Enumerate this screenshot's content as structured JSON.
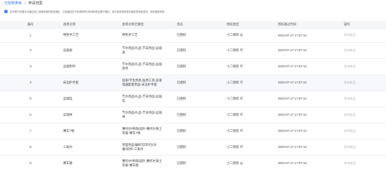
{
  "breadcrumb": {
    "parent": "已授权类目",
    "current": "申请范围"
  },
  "notice": {
    "text": "本列表中仅展示已通过线上流程申请的类目授权，之前通过线下申请获得已申请的类目暂不展示，如不影响您的发布授权的商品发布，请您重新申请"
  },
  "table": {
    "headers": [
      "编号",
      "类目名称",
      "类目名称全路径",
      "状态",
      "授权类型",
      "授权通过时间",
      "操作"
    ],
    "rows": [
      {
        "idx": "1",
        "name": "特色手工艺",
        "path": [
          "特色手工艺"
        ],
        "status": "已授权",
        "type": "小二授权",
        "time": "2023-07-17 17:07:13",
        "action": "发布商品"
      },
      {
        "idx": "2",
        "name": "盆栽类",
        "path": [
          "节水用品/礼品-节日用品-盆栽",
          "类"
        ],
        "status": "已授权",
        "type": "小二授权",
        "time": "2023-07-17 17:07:13",
        "action": "发布商品"
      },
      {
        "idx": "3",
        "name": "盆栽附件",
        "path": [
          "节水用品/礼品-节日用品-盆栽",
          "附件"
        ],
        "status": "已授权",
        "type": "小二授权",
        "time": "2023-07-17 17:07:13",
        "action": "发布商品"
      },
      {
        "idx": "4",
        "name": "床边护手套",
        "path": [
          "居家/学生用具-医用工具-居家",
          "电器配套用品-床边护手套"
        ],
        "status": "已授权",
        "type": "小二授权",
        "time": "2023-07-17 17:07:13",
        "action": "发布商品"
      },
      {
        "idx": "5",
        "name": "盆栽桂",
        "path": [
          "节水用品/礼品-节日用品-盆栽",
          "桂"
        ],
        "status": "已授权",
        "type": "小二授权",
        "time": "2023-07-17 17:07:13",
        "action": "发布商品"
      },
      {
        "idx": "6",
        "name": "盆栽林",
        "path": [
          "节水用品/礼品-节日用品-盆栽",
          "林"
        ],
        "status": "已授权",
        "type": "小二授权",
        "time": "2023-07-17 17:07:13",
        "action": "发布商品"
      },
      {
        "idx": "7",
        "name": "赛车T恤",
        "path": [
          "赛托尔/摔角/国外-赛托尔骑士",
          "装备-赛车T恤"
        ],
        "status": "已授权",
        "type": "小二授权",
        "time": "2023-07-17 17:07:13",
        "action": "发布商品"
      },
      {
        "idx": "8",
        "name": "三角巾",
        "path": [
          "荣誉用品/编织/饮料/包/冰",
          "箱/袋/织-三角巾"
        ],
        "status": "已授权",
        "type": "小二授权",
        "time": "2023-07-17 17:07:13",
        "action": "发布商品"
      },
      {
        "idx": "9",
        "name": "赛车服",
        "path": [
          "赛托尔/摔角/国外-赛托尔骑士",
          "装备-赛车服"
        ],
        "status": "已授权",
        "type": "小二授权",
        "time": "2023-07-17 17:07:13",
        "action": "发布商品"
      }
    ]
  }
}
